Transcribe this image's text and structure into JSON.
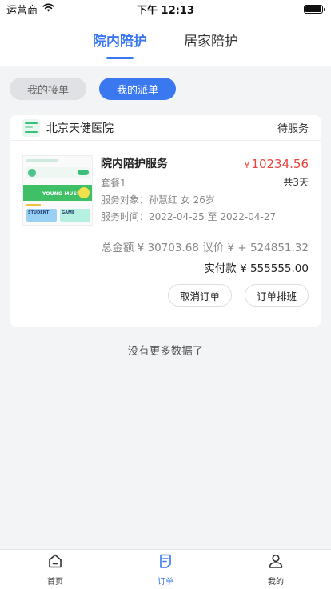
{
  "status_bar": {
    "carrier": "运营商",
    "time": "下午 12:13"
  },
  "top_tabs": [
    {
      "label": "院内陪护",
      "active": true
    },
    {
      "label": "居家陪护",
      "active": false
    }
  ],
  "sub_tabs": [
    {
      "label": "我的接单",
      "active": false
    },
    {
      "label": "我的派单",
      "active": true
    }
  ],
  "order": {
    "hospital": "北京天健医院",
    "status": "待服务",
    "thumbnail": {
      "banner_text": "YOUNG MUSIC",
      "tile_a": "STUDENT",
      "tile_b": "GAME"
    },
    "service_title": "院内陪护服务",
    "package": "套餐1",
    "target": "服务对象：孙慧红 女 26岁",
    "time": "服务时间：2022-04-25 至 2022-04-27",
    "price_symbol": "¥",
    "price": "10234.56",
    "days": "共3天",
    "total_line": "总金额 ¥ 30703.68  议价 ¥ + 524851.32",
    "paid_line": "实付款 ¥ 555555.00",
    "actions": {
      "cancel": "取消订单",
      "schedule": "订单排班"
    }
  },
  "no_more": "没有更多数据了",
  "tabbar": [
    {
      "label": "首页",
      "icon": "home-icon",
      "active": false
    },
    {
      "label": "订单",
      "icon": "order-icon",
      "active": true
    },
    {
      "label": "我的",
      "icon": "profile-icon",
      "active": false
    }
  ],
  "colors": {
    "accent": "#3a78f0",
    "price": "#e8453c"
  }
}
